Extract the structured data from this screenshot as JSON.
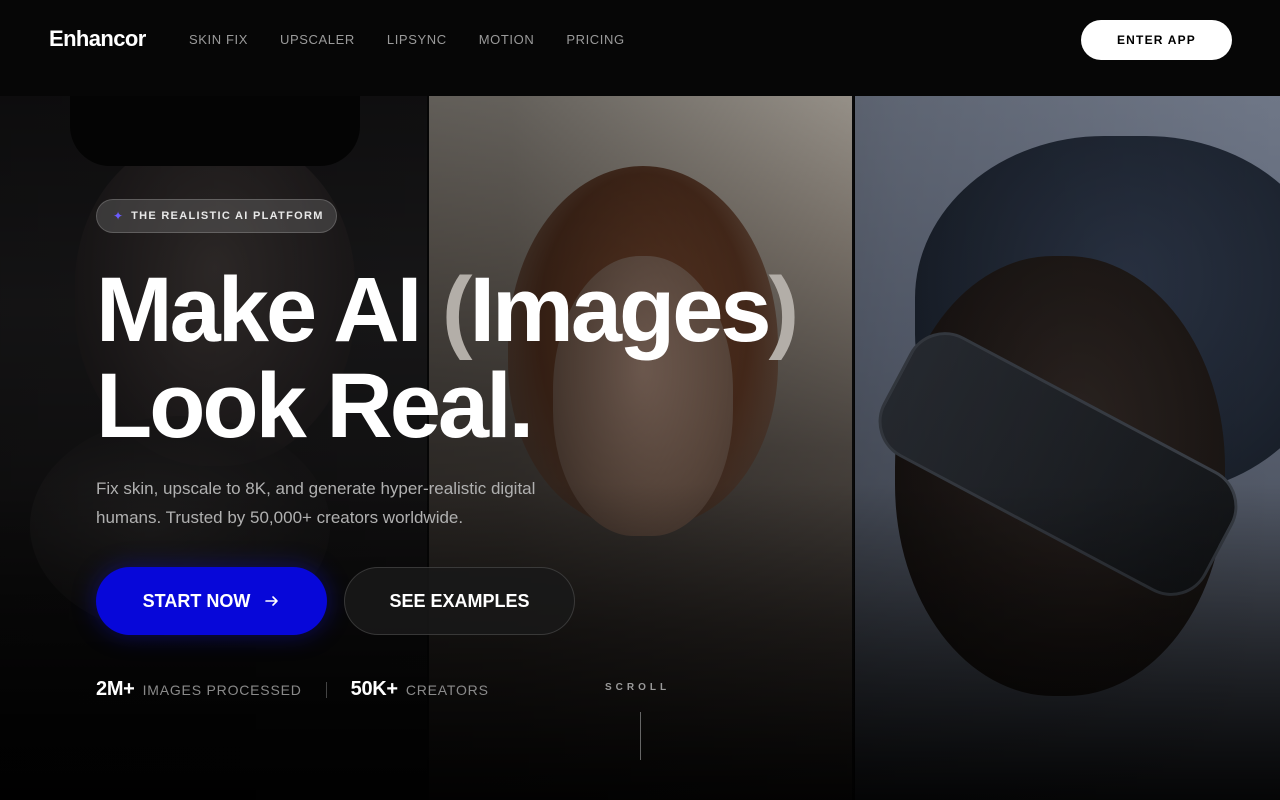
{
  "header": {
    "logo": "Enhancor",
    "nav": [
      "SKIN FIX",
      "UPSCALER",
      "LIPSYNC",
      "MOTION",
      "PRICING"
    ],
    "cta": "ENTER APP"
  },
  "hero": {
    "badge": {
      "icon": "sparkle-icon",
      "text": "THE REALISTIC AI PLATFORM"
    },
    "headline": {
      "part1": "Make AI ",
      "open_paren": "(",
      "word": "Images",
      "close_paren": ")",
      "line2": "Look Real."
    },
    "subtext": "Fix skin, upscale to 8K, and generate hyper-realistic digital humans. Trusted by 50,000+ creators worldwide.",
    "primary_button": "START NOW",
    "primary_icon": "arrow-right-icon",
    "secondary_button": "SEE EXAMPLES",
    "stats": [
      {
        "value": "2M+",
        "label": "IMAGES PROCESSED"
      },
      {
        "value": "50K+",
        "label": "CREATORS"
      }
    ],
    "scroll": "SCROLL"
  },
  "colors": {
    "background": "#060606",
    "primary": "#0707d9",
    "text_muted": "#b0b0b0",
    "accent_icon": "#6b5cff"
  }
}
